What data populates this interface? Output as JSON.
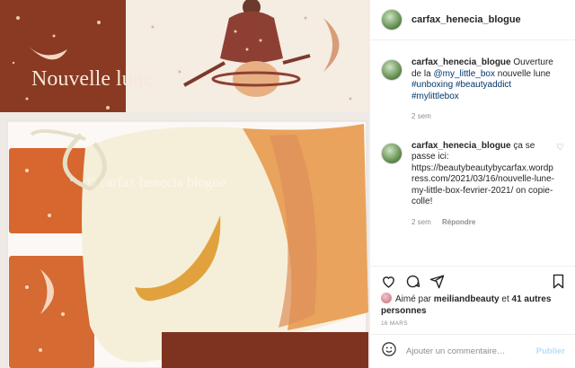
{
  "post": {
    "username": "carfax_henecia_blogue",
    "photo_texts": {
      "box_text": "Nouvelle lune",
      "watermark": "© carfax henecia blogue"
    },
    "caption": {
      "username": "carfax_henecia_blogue",
      "text_1": "Ouverture de la",
      "mention": "@my_little_box",
      "text_2": "nouvelle lune",
      "hashtags": [
        "#unboxing",
        "#beautyaddict",
        "#mylittlebox"
      ],
      "time": "2 sem"
    },
    "comment": {
      "username": "carfax_henecia_blogue",
      "text": "ça se passe ici: https://beautybeautybycarfax.wordpress.com/2021/03/16/nouvelle-lune-my-little-box-fevrier-2021/ on copie-colle!",
      "time": "2 sem",
      "reply_label": "Répondre"
    },
    "likes": {
      "prefix": "Aimé par",
      "user": "meiliandbeauty",
      "middle": "et",
      "others": "41 autres personnes"
    },
    "date": "16 MARS",
    "comment_box": {
      "placeholder": "Ajouter un commentaire…",
      "publish_label": "Publier"
    }
  }
}
